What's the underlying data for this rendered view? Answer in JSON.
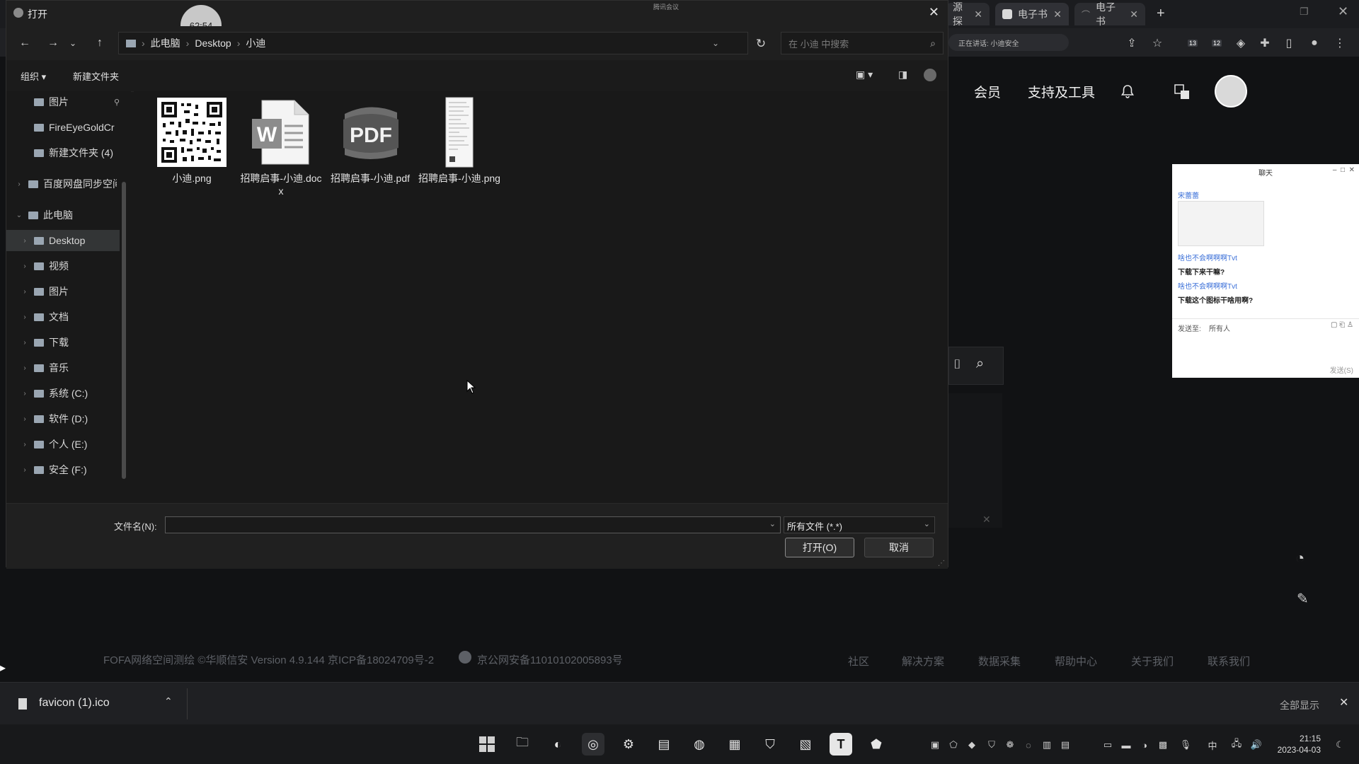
{
  "browser": {
    "tabs": [
      {
        "label": "资源探测"
      },
      {
        "label": "电子书"
      },
      {
        "label": "电子书"
      }
    ],
    "url_fragment": "正在讲话: 小迪安全",
    "extension_badges": [
      "13",
      "12"
    ],
    "site_header": {
      "member": "会员",
      "tools": "支持及工具"
    },
    "footer": {
      "copyright": "FOFA网络空间测绘 ©华顺信安 Version 4.9.144 京ICP备18024709号-2",
      "police": "京公网安备11010102005893号",
      "links": [
        "社区",
        "解决方案",
        "数据采集",
        "帮助中心",
        "关于我们",
        "联系我们"
      ]
    }
  },
  "meeting": {
    "timer": "62:54",
    "label": "腾讯会议"
  },
  "chat": {
    "title": "聊天",
    "sender": "宋蕾蕾",
    "messages": [
      {
        "text": "啥也不会啊啊啊Tvt",
        "style": "name"
      },
      {
        "text": "下载下来干嘛?",
        "style": "body"
      },
      {
        "text": "啥也不会啊啊啊Tvt",
        "style": "name"
      },
      {
        "text": "下载这个图标干啥用啊?",
        "style": "body"
      }
    ],
    "send_to_label": "发送至:",
    "send_to_value": "所有人",
    "send_button": "发送(S)"
  },
  "dialog": {
    "title": "打开",
    "breadcrumb": [
      "此电脑",
      "Desktop",
      "小迪"
    ],
    "search_placeholder": "在 小迪 中搜索",
    "toolbar": {
      "organize": "组织 ▾",
      "new_folder": "新建文件夹"
    },
    "sidebar": [
      {
        "label": "图片",
        "icon": "picture-icon",
        "indent": 1,
        "pinned": true
      },
      {
        "label": "FireEyeGoldCr",
        "icon": "folder-icon",
        "indent": 1
      },
      {
        "label": "新建文件夹 (4)",
        "icon": "folder-icon",
        "indent": 1
      },
      {
        "label": "百度网盘同步空间",
        "icon": "cloud-drive-icon",
        "indent": 0,
        "chevron": "›"
      },
      {
        "label": "此电脑",
        "icon": "pc-icon",
        "indent": 0,
        "chevron": "⌄"
      },
      {
        "label": "Desktop",
        "icon": "desktop-icon",
        "indent": 1,
        "chevron": "›",
        "selected": true
      },
      {
        "label": "视频",
        "icon": "video-icon",
        "indent": 1,
        "chevron": "›"
      },
      {
        "label": "图片",
        "icon": "picture-icon",
        "indent": 1,
        "chevron": "›"
      },
      {
        "label": "文档",
        "icon": "document-icon",
        "indent": 1,
        "chevron": "›"
      },
      {
        "label": "下载",
        "icon": "download-icon",
        "indent": 1,
        "chevron": "›"
      },
      {
        "label": "音乐",
        "icon": "music-icon",
        "indent": 1,
        "chevron": "›"
      },
      {
        "label": "系统 (C:)",
        "icon": "drive-icon",
        "indent": 1,
        "chevron": "›"
      },
      {
        "label": "软件 (D:)",
        "icon": "drive-icon",
        "indent": 1,
        "chevron": "›"
      },
      {
        "label": "个人 (E:)",
        "icon": "drive-icon",
        "indent": 1,
        "chevron": "›"
      },
      {
        "label": "安全 (F:)",
        "icon": "drive-icon",
        "indent": 1,
        "chevron": "›"
      }
    ],
    "files": [
      {
        "name": "小迪.png",
        "kind": "qr-image"
      },
      {
        "name": "招聘启事-小迪.docx",
        "kind": "word"
      },
      {
        "name": "招聘启事-小迪.pdf",
        "kind": "pdf"
      },
      {
        "name": "招聘启事-小迪.png",
        "kind": "page-image"
      }
    ],
    "filename_label": "文件名(N):",
    "filename_value": "",
    "filetype_value": "所有文件 (*.*)",
    "open_button": "打开(O)",
    "cancel_button": "取消"
  },
  "download_bar": {
    "filename": "favicon (1).ico",
    "show_all": "全部显示"
  },
  "taskbar": {
    "ime": "中",
    "time": "21:15",
    "date": "2023-04-03"
  }
}
